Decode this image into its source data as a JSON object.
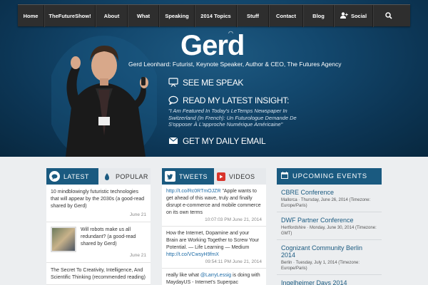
{
  "nav": {
    "items": [
      {
        "label": "Home",
        "icon": ""
      },
      {
        "label": "TheFutureShow!",
        "icon": ""
      },
      {
        "label": "About",
        "icon": ""
      },
      {
        "label": "What",
        "icon": ""
      },
      {
        "label": "Speaking",
        "icon": ""
      },
      {
        "label": "2014 Topics",
        "icon": ""
      },
      {
        "label": "Stuff",
        "icon": ""
      },
      {
        "label": "Contact",
        "icon": ""
      },
      {
        "label": "Blog",
        "icon": ""
      },
      {
        "label": "Social",
        "icon": "user-plus-icon"
      },
      {
        "label": "",
        "icon": "search-icon"
      }
    ]
  },
  "hero": {
    "logo": "Gerd",
    "tagline": "Gerd Leonhard: Futurist, Keynote Speaker, Author & CEO, The Futures Agency",
    "see_me_speak": "SEE ME SPEAK",
    "read_insight": "READ MY LATEST INSIGHT:",
    "quote": "\"I Am Featured In Today's LeTemps Newspaper In Switzerland (In French): Un Futurologue Demande De S'opposer À L'approche Numérique Américaine\"",
    "daily_email": "GET MY DAILY EMAIL"
  },
  "posts_widget": {
    "tab_latest": "LATEST",
    "tab_popular": "POPULAR",
    "posts": [
      {
        "text": "10 mindblowingly futuristic technologies that will appear by the 2030s (a good-read shared by Gerd)",
        "date": "June 21"
      },
      {
        "text": "Will robots make us all redundant? (a good-read shared by Gerd)",
        "date": "June 21"
      },
      {
        "text": "The Secret To Creativity, Intelligence, And Scientific Thinking (recommended reading)",
        "date": ""
      }
    ]
  },
  "tweets_widget": {
    "tab_tweets": "TWEETS",
    "tab_videos": "VIDEOS",
    "tweets": [
      {
        "link": "http://t.co/Rc0RTmOJZR",
        "text": " \"Apple wants to get ahead of this wave, truly and finally disrupt e-commerce and mobile commerce on its own terms",
        "date": "10:07:03 PM June 21, 2014"
      },
      {
        "link": "",
        "text": "How the Internet, Dopamine and your Brain are Working Together to Screw Your Potential. — Life Learning — Medium ",
        "link2": "http://t.co/VCwsyH9fmX",
        "date": "09:54:11 PM June 21, 2014"
      },
      {
        "text_pre": "really like what ",
        "mention": "@LarryLessig",
        "text": " is doing with MaydayUS - Internet's Superpac",
        "date": ""
      }
    ]
  },
  "events_widget": {
    "title": "UPCOMING EVENTS",
    "events": [
      {
        "title": "CBRE Conference",
        "meta": "Mallorca · Thursday, June 26, 2014 (Timezone: Europe/Paris)"
      },
      {
        "title": "DWF Partner Conference",
        "meta": "Hertfordshire · Monday, June 30, 2014 (Timezone: GMT)"
      },
      {
        "title": "Cognizant Community Berlin 2014",
        "meta": "Berlin · Tuesday, July 1, 2014 (Timezone: Europe/Paris)"
      },
      {
        "title": "Ingelheimer Days 2014",
        "meta": ""
      }
    ]
  },
  "colors": {
    "accent": "#1a5a80",
    "nav_bg": "#2e2e2e",
    "hero_bg": "#13486e",
    "link": "#1b6aa5"
  }
}
